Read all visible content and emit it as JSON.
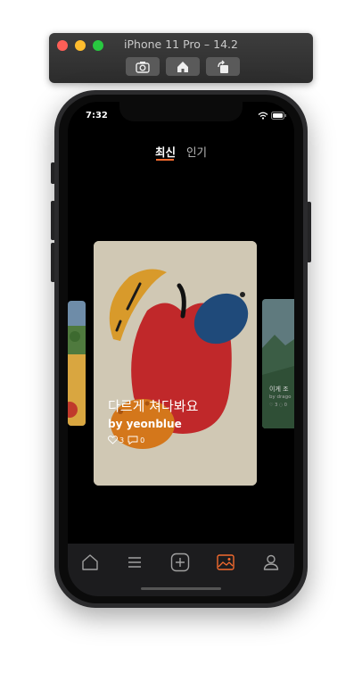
{
  "simulator": {
    "title": "iPhone 11 Pro – 14.2",
    "buttons": [
      "screenshot",
      "home",
      "rotate"
    ]
  },
  "status_bar": {
    "time": "7:32"
  },
  "tabs": [
    {
      "label": "최신",
      "active": true
    },
    {
      "label": "인기",
      "active": false
    }
  ],
  "cards": {
    "main": {
      "title": "다르게 쳐다봐요",
      "author": "by yeonblue",
      "likes": "3",
      "comments": "0"
    },
    "right": {
      "title": "이게 조",
      "author": "by drago",
      "stats": "♡ 3 ◌ 0"
    }
  },
  "tab_bar": {
    "items": [
      "home-icon",
      "list-icon",
      "add-icon",
      "gallery-icon",
      "profile-icon"
    ],
    "active": "gallery-icon"
  },
  "colors": {
    "accent": "#f26a2e",
    "background": "#000000",
    "tabbar": "#1c1c1e",
    "card_bg": "#d0c8b4"
  }
}
